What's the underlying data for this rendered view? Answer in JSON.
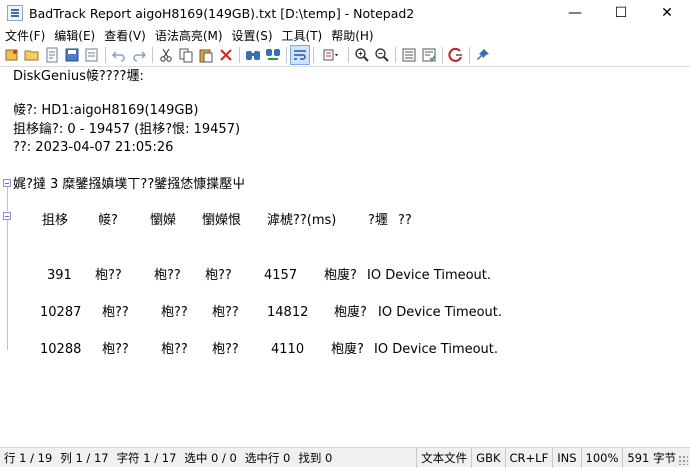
{
  "window": {
    "title": "BadTrack Report aigoH8169(149GB).txt [D:\\temp] - Notepad2",
    "minimize_glyph": "—",
    "maximize_glyph": "☐",
    "close_glyph": "✕"
  },
  "menu": {
    "items": [
      "文件(F)",
      "编辑(E)",
      "查看(V)",
      "语法高亮(M)",
      "设置(S)",
      "工具(T)",
      "帮助(H)"
    ]
  },
  "toolbar": {
    "buttons": [
      "new-icon",
      "open-icon",
      "browse-icon",
      "save-icon",
      "undo-icon",
      "redo-icon",
      "cut-icon",
      "copy-icon",
      "paste-icon",
      "delete-icon",
      "find-icon",
      "replace-icon",
      "word-wrap-icon",
      "scheme-icon",
      "zoom-in-icon",
      "zoom-out-icon",
      "settings-icon",
      "save-settings-icon",
      "exit-icon",
      "pin-icon"
    ]
  },
  "document": {
    "header": "DiskGenius帹????壥:",
    "disk": "帹?: HD1:aigoH8169(149GB)",
    "range": "抯栘鑰?: 0 - 19457 (抯栘?恨: 19457)",
    "time": "??: 2023-04-07 21:05:26",
    "summary": "娓?撻 3 糜鐾摾嫃墣丅??鐾摾恷慷揲壓屮",
    "columns": [
      "抯栘",
      "帹?",
      "懰嬫",
      "懰嬫恨",
      "滹椃??(ms)",
      "?壥",
      "??"
    ],
    "rows": [
      {
        "c1": "391",
        "c2": "枹??",
        "c3": "枹??",
        "c4": "枹??",
        "c5": "4157",
        "c6": "枹廋?",
        "c7": "IO Device Timeout."
      },
      {
        "c1": "10287",
        "c2": "枹??",
        "c3": "枹??",
        "c4": "枹??",
        "c5": "14812",
        "c6": "枹廋?",
        "c7": "IO Device Timeout."
      },
      {
        "c1": "10288",
        "c2": "枹??",
        "c3": "枹??",
        "c4": "枹??",
        "c5": "4110",
        "c6": "枹廋?",
        "c7": "IO Device Timeout."
      }
    ]
  },
  "status": {
    "line": "行 1 / 19",
    "col": "列 1 / 17",
    "char": "字符 1 / 17",
    "sel": "选中 0 / 0",
    "sel_lines": "选中行 0",
    "found": "找到 0",
    "type": "文本文件",
    "encoding": "GBK",
    "eol": "CR+LF",
    "ins": "INS",
    "zoom": "100%",
    "size": "591 字节"
  },
  "colors": {
    "accent": "#3a6fb3",
    "fold_margin": "#b9b9ff"
  }
}
